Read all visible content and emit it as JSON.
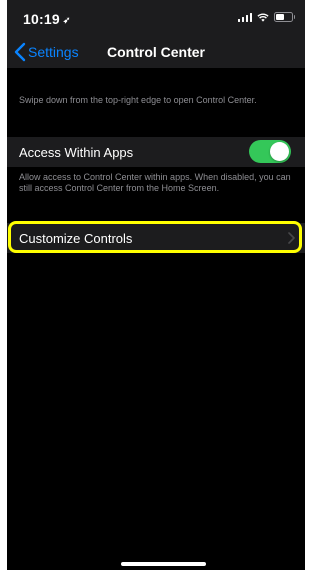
{
  "status_bar": {
    "time": "10:19",
    "icons": [
      "location-arrow-icon",
      "cellular-signal-icon",
      "wifi-icon",
      "battery-icon"
    ],
    "battery_level": 0.6
  },
  "nav": {
    "back_label": "Settings",
    "title": "Control Center"
  },
  "content": {
    "description": "Swipe down from the top-right edge to open Control Center.",
    "access_within_apps": {
      "label": "Access Within Apps",
      "enabled": true,
      "footer": "Allow access to Control Center within apps. When disabled, you can still access Control Center from the Home Screen."
    },
    "customize_controls": {
      "label": "Customize Controls"
    }
  },
  "colors": {
    "accent": "#0a84ff",
    "toggle_on": "#34c759",
    "highlight": "#ffff00",
    "background": "#000000",
    "cell": "#1c1c1e",
    "secondary_text": "#8e8e93"
  }
}
